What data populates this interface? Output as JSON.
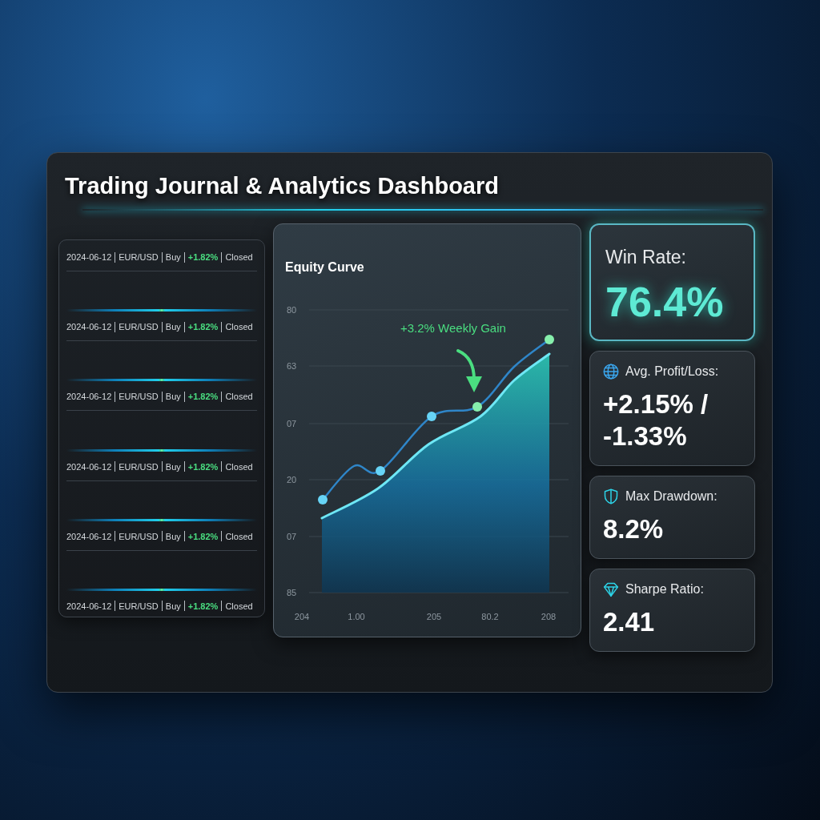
{
  "window": {
    "title": "Trading Journal & Analytics Dashboard"
  },
  "trades": [
    {
      "date": "2024-06-12",
      "pair": "EUR/USD",
      "side": "Buy",
      "pnl": "+1.82%",
      "status": "Closed"
    },
    {
      "date": "2024-06-12",
      "pair": "EUR/USD",
      "side": "Buy",
      "pnl": "+1.82%",
      "status": "Closed"
    },
    {
      "date": "2024-06-12",
      "pair": "EUR/USD",
      "side": "Buy",
      "pnl": "+1.82%",
      "status": "Closed"
    },
    {
      "date": "2024-06-12",
      "pair": "EUR/USD",
      "side": "Buy",
      "pnl": "+1.82%",
      "status": "Closed"
    },
    {
      "date": "2024-06-12",
      "pair": "EUR/USD",
      "side": "Buy",
      "pnl": "+1.82%",
      "status": "Closed"
    },
    {
      "date": "2024-06-12",
      "pair": "EUR/USD",
      "side": "Buy",
      "pnl": "+1.82%",
      "status": "Closed"
    }
  ],
  "chart": {
    "title": "Equity Curve",
    "y_tick_labels": [
      "80",
      "63",
      "07",
      "20",
      "07",
      "85"
    ],
    "x_tick_labels": [
      "204",
      "1.00",
      "205",
      "80.2",
      "208"
    ],
    "annotation": "+3.2% Weekly Gain"
  },
  "metrics": [
    {
      "kind": "winrate",
      "label": "Win Rate:",
      "value": "76.4%",
      "highlighted": true
    },
    {
      "kind": "profit",
      "label": "Avg. Profit/Loss:",
      "value": "+2.15% / -1.33%",
      "highlighted": false
    },
    {
      "kind": "drawdown",
      "label": "Max Drawdown:",
      "value": "8.2%",
      "highlighted": false
    },
    {
      "kind": "sharpe",
      "label": "Sharpe Ratio:",
      "value": "2.41",
      "highlighted": false
    }
  ]
}
